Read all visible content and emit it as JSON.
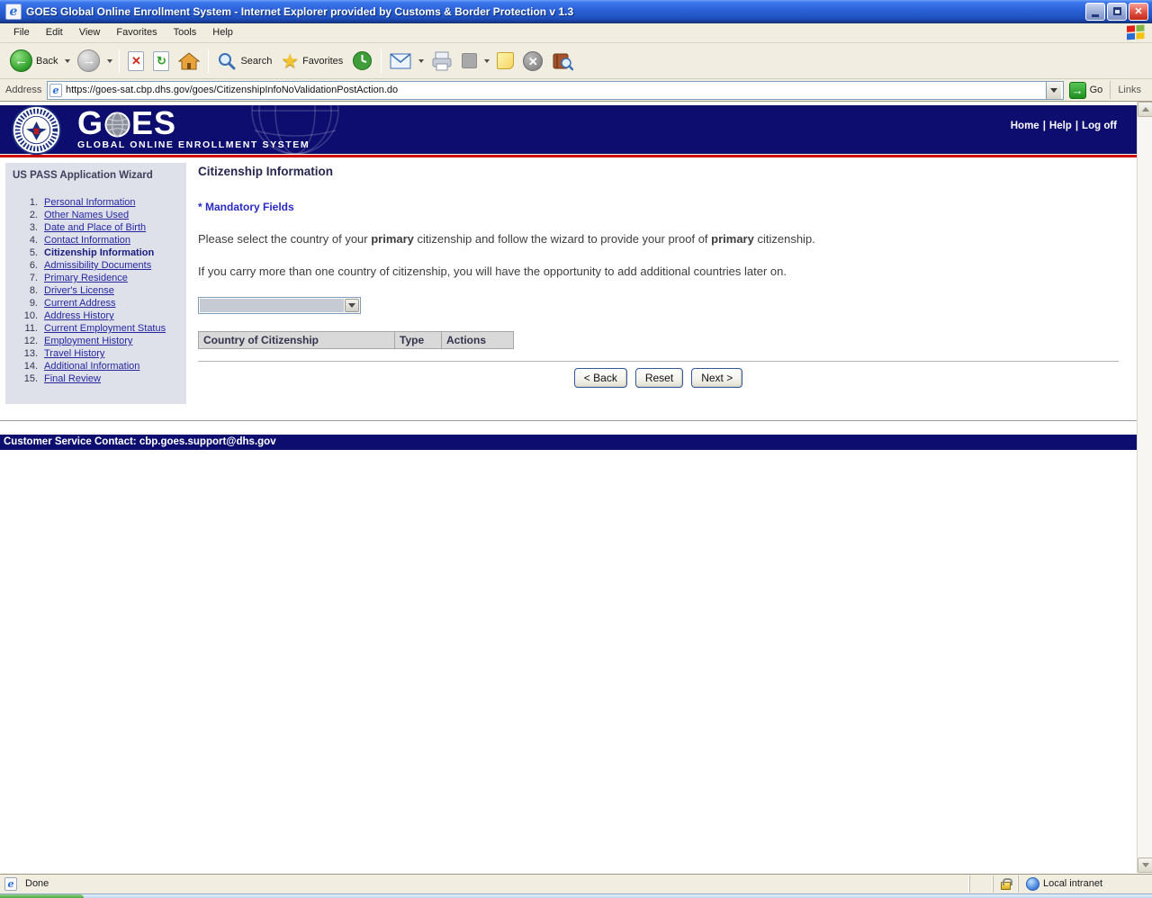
{
  "window": {
    "title": "GOES Global Online Enrollment System - Internet Explorer provided by Customs & Border Protection v 1.3"
  },
  "menu": {
    "items": [
      "File",
      "Edit",
      "View",
      "Favorites",
      "Tools",
      "Help"
    ]
  },
  "toolbar": {
    "back": "Back",
    "search": "Search",
    "favorites": "Favorites"
  },
  "address": {
    "label": "Address",
    "url": "https://goes-sat.cbp.dhs.gov/goes/CitizenshipInfoNoValidationPostAction.do",
    "go": "Go",
    "links": "Links"
  },
  "header": {
    "logo_g": "G",
    "logo_es": "ES",
    "subtitle": "GLOBAL ONLINE ENROLLMENT SYSTEM",
    "nav_items": [
      "Home",
      "Help",
      "Log off"
    ],
    "nav_separator": "|"
  },
  "sidebar": {
    "title": "US PASS Application Wizard",
    "items": [
      {
        "num": "1.",
        "label": "Personal Information",
        "current": false
      },
      {
        "num": "2.",
        "label": "Other Names Used",
        "current": false
      },
      {
        "num": "3.",
        "label": "Date and Place of Birth",
        "current": false
      },
      {
        "num": "4.",
        "label": "Contact Information",
        "current": false
      },
      {
        "num": "5.",
        "label": "Citizenship Information",
        "current": true
      },
      {
        "num": "6.",
        "label": "Admissibility Documents",
        "current": false
      },
      {
        "num": "7.",
        "label": "Primary Residence",
        "current": false
      },
      {
        "num": "8.",
        "label": "Driver's License",
        "current": false
      },
      {
        "num": "9.",
        "label": "Current Address",
        "current": false
      },
      {
        "num": "10.",
        "label": "Address History",
        "current": false
      },
      {
        "num": "11.",
        "label": "Current Employment Status",
        "current": false
      },
      {
        "num": "12.",
        "label": "Employment History",
        "current": false
      },
      {
        "num": "13.",
        "label": "Travel History",
        "current": false
      },
      {
        "num": "14.",
        "label": "Additional Information",
        "current": false
      },
      {
        "num": "15.",
        "label": "Final Review",
        "current": false
      }
    ]
  },
  "main": {
    "heading": "Citizenship Information",
    "mandatory_note": "* Mandatory Fields",
    "para1": [
      "Please select the country of your ",
      "primary",
      " citizenship and follow the wizard to provide your proof of ",
      "primary",
      " citizenship."
    ],
    "para2": "If you carry more than one country of citizenship, you will have the opportunity to add additional countries later on.",
    "table_headers": [
      "Country of Citizenship",
      "Type",
      "Actions"
    ],
    "buttons": {
      "back": "< Back",
      "reset": "Reset",
      "next": "Next >"
    }
  },
  "footer": {
    "text": "Customer Service Contact: cbp.goes.support@dhs.gov"
  },
  "statusbar": {
    "status": "Done",
    "zone": "Local intranet"
  },
  "colors": {
    "navy": "#0d0d70",
    "red_rule": "#cc0000",
    "link": "#2626a0",
    "sidebar_bg": "#dee1ea",
    "titlebar_blue": "#2a60d8"
  }
}
